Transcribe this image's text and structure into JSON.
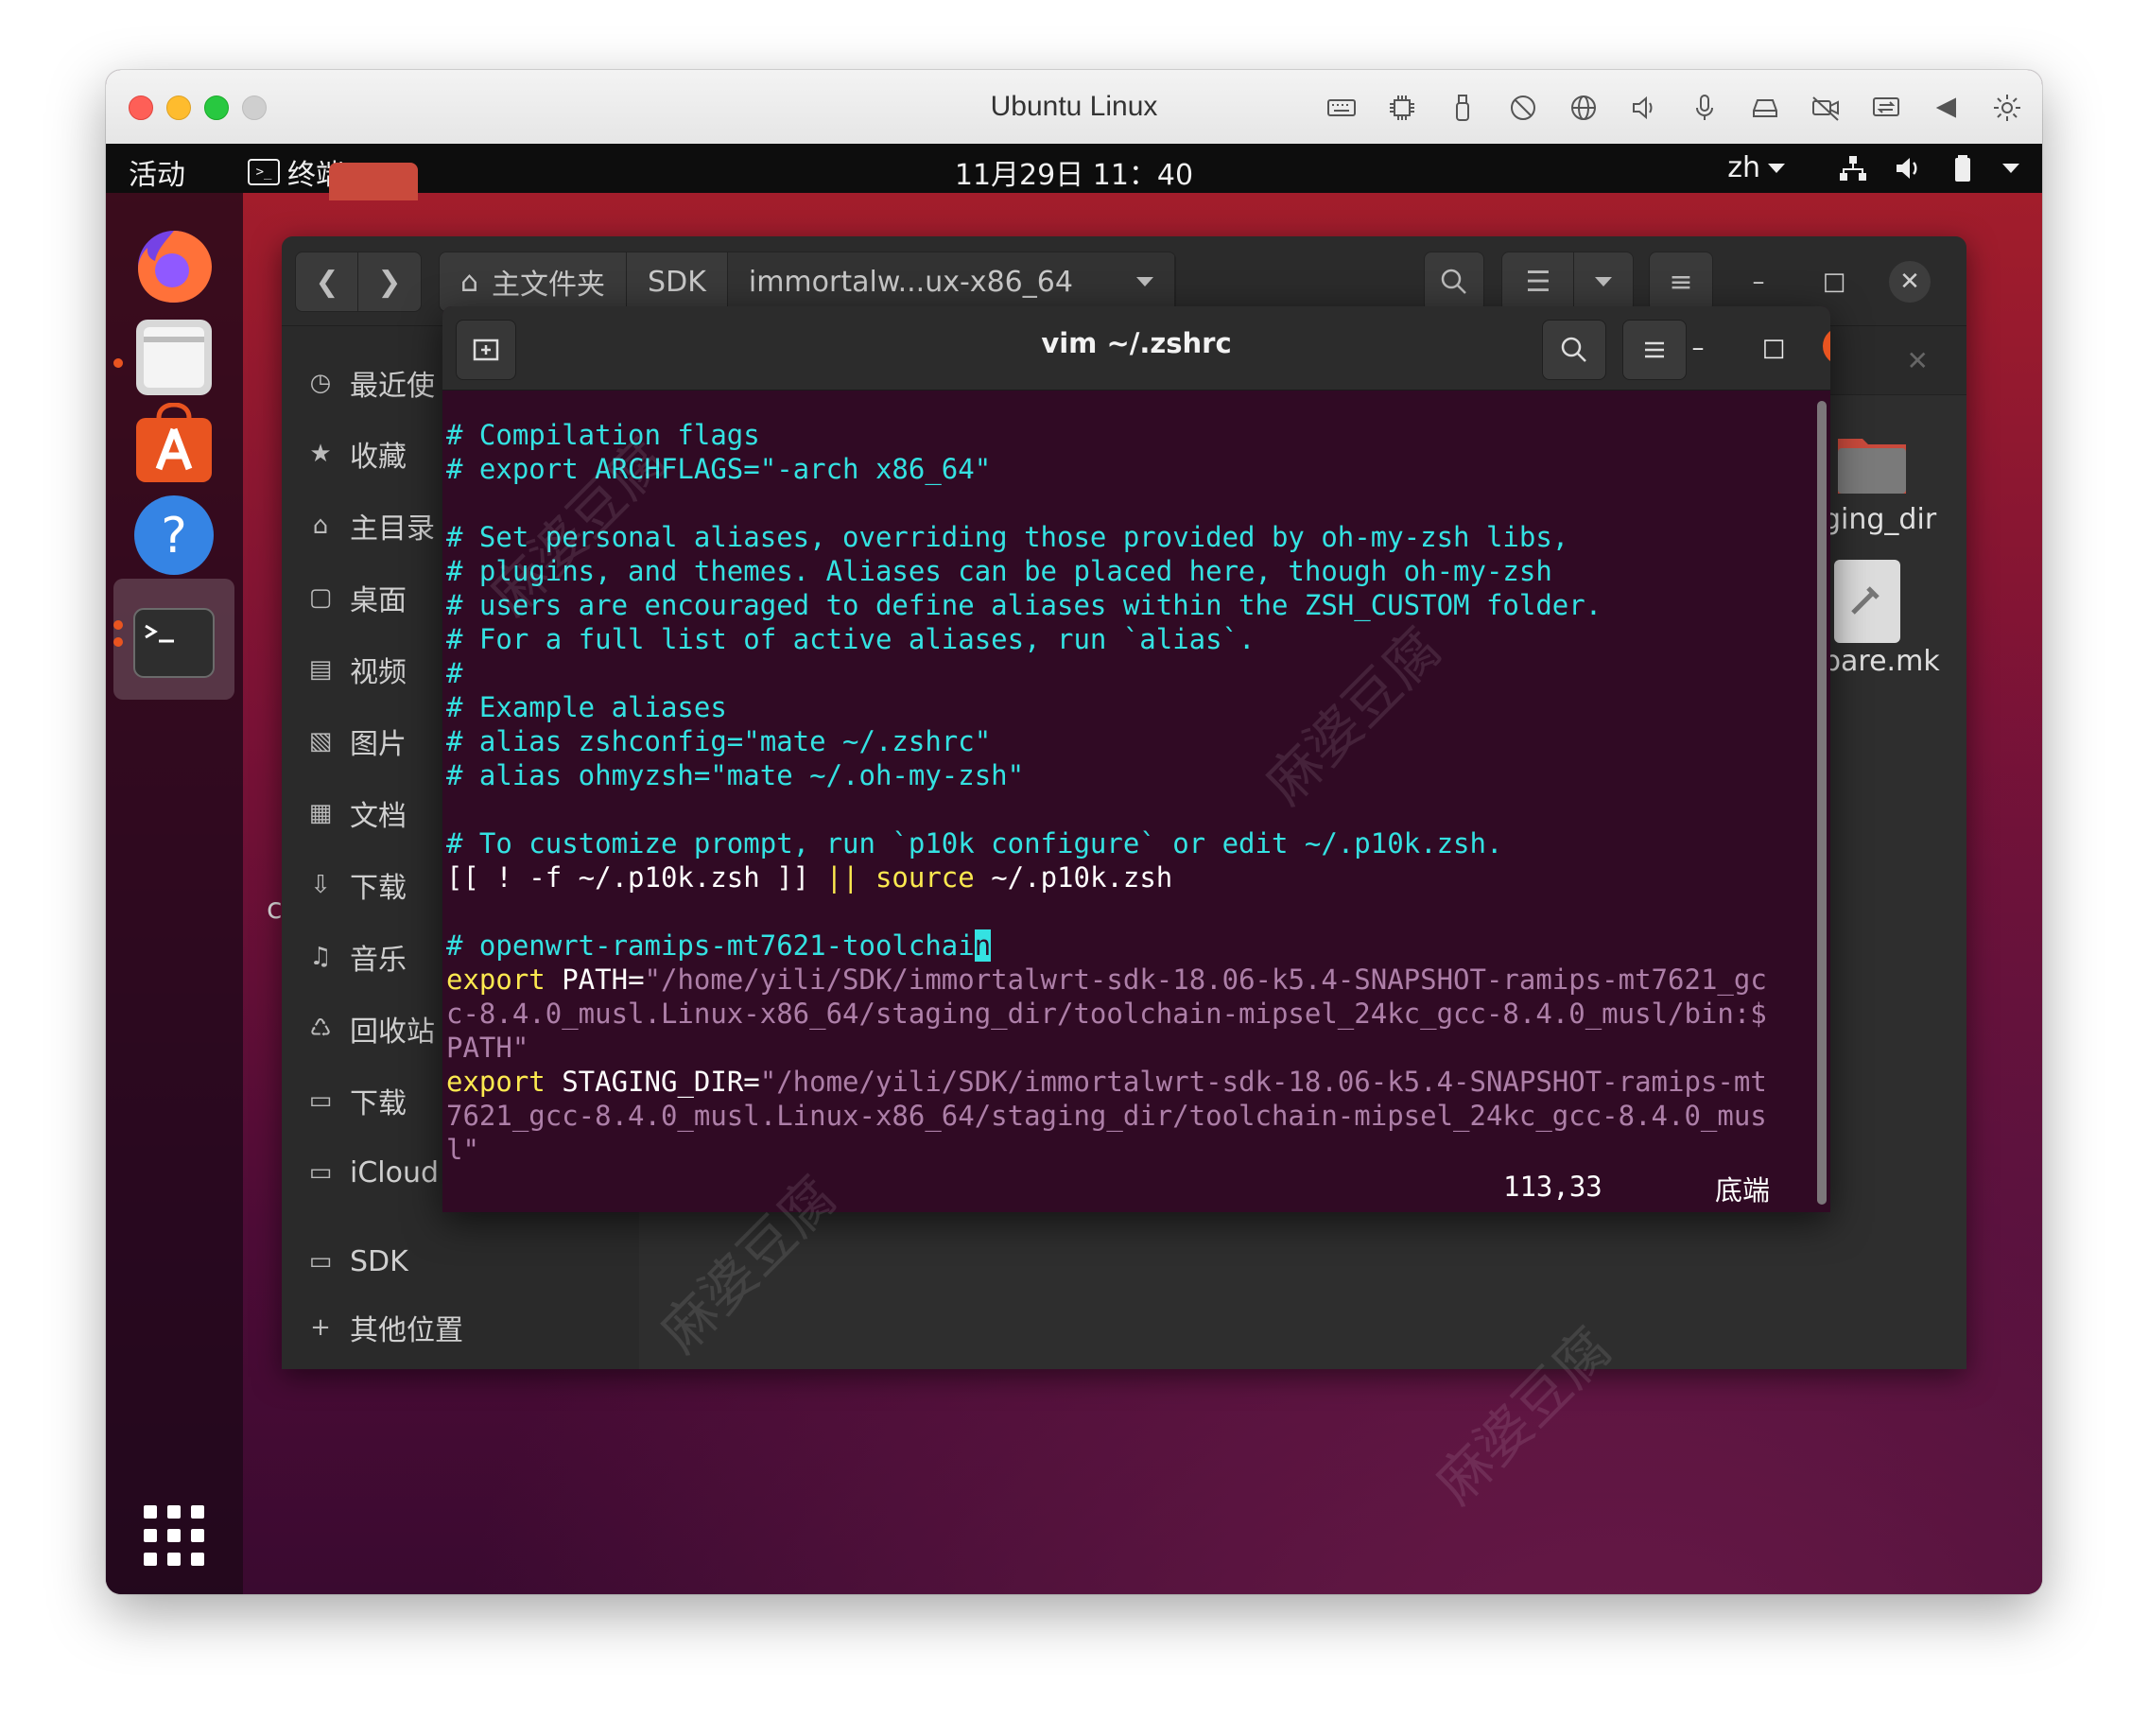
{
  "host": {
    "title": "Ubuntu Linux",
    "tools": [
      "keyboard-icon",
      "cpu-icon",
      "usb-icon",
      "disabled-icon",
      "network-globe-icon",
      "speaker-icon",
      "microphone-icon",
      "drive-icon",
      "camera-off-icon",
      "display-share-icon",
      "back-arrow-icon",
      "settings-gear-icon"
    ]
  },
  "topbar": {
    "activities": "活动",
    "app_name": "终端",
    "clock": "11月29日  11：40",
    "lang": "zh"
  },
  "files": {
    "breadcrumbs": [
      "主文件夹",
      "SDK",
      "immortalw...ux-x86_64"
    ],
    "sidebar": [
      {
        "icon": "clock-icon",
        "glyph": "◷",
        "label": "最近使"
      },
      {
        "icon": "star-icon",
        "glyph": "★",
        "label": "收藏"
      },
      {
        "icon": "home-icon",
        "glyph": "⌂",
        "label": "主目录"
      },
      {
        "icon": "desktop-icon",
        "glyph": "▢",
        "label": "桌面"
      },
      {
        "icon": "video-icon",
        "glyph": "▤",
        "label": "视频"
      },
      {
        "icon": "image-icon",
        "glyph": "▧",
        "label": "图片"
      },
      {
        "icon": "document-icon",
        "glyph": "▦",
        "label": "文档"
      },
      {
        "icon": "download-icon",
        "glyph": "⇩",
        "label": "下载"
      },
      {
        "icon": "music-icon",
        "glyph": "♫",
        "label": "音乐"
      },
      {
        "icon": "trash-icon",
        "glyph": "♺",
        "label": "回收站"
      },
      {
        "icon": "drive-icon",
        "glyph": "▭",
        "label": "下载"
      },
      {
        "icon": "drive-icon",
        "glyph": "▭",
        "label": "iCloud"
      },
      {
        "icon": "folder-icon",
        "glyph": "▭",
        "label": "SDK"
      },
      {
        "icon": "plus-icon",
        "glyph": "+",
        "label": "其他位置"
      }
    ],
    "content_items": [
      {
        "label": "ging_dir"
      },
      {
        "label": "pare.mk"
      }
    ],
    "desktop_letter": "c"
  },
  "terminal": {
    "title": "vim ~/.zshrc",
    "lines": [
      [
        [
          "c-comment",
          "# Compilation flags"
        ]
      ],
      [
        [
          "c-comment",
          "# export ARCHFLAGS=\"-arch x86_64\""
        ]
      ],
      [],
      [
        [
          "c-comment",
          "# Set personal aliases, overriding those provided by oh-my-zsh libs,"
        ]
      ],
      [
        [
          "c-comment",
          "# plugins, and themes. Aliases can be placed here, though oh-my-zsh"
        ]
      ],
      [
        [
          "c-comment",
          "# users are encouraged to define aliases within the ZSH_CUSTOM folder."
        ]
      ],
      [
        [
          "c-comment",
          "# For a full list of active aliases, run `alias`."
        ]
      ],
      [
        [
          "c-comment",
          "#"
        ]
      ],
      [
        [
          "c-comment",
          "# Example aliases"
        ]
      ],
      [
        [
          "c-comment",
          "# alias zshconfig=\"mate ~/.zshrc\""
        ]
      ],
      [
        [
          "c-comment",
          "# alias ohmyzsh=\"mate ~/.oh-my-zsh\""
        ]
      ],
      [],
      [
        [
          "c-comment",
          "# To customize prompt, run `p10k configure` or edit ~/.p10k.zsh."
        ]
      ],
      [
        [
          "c-plain",
          "[[ ! -f ~/.p10k.zsh ]] "
        ],
        [
          "c-kw",
          "||"
        ],
        [
          "c-plain",
          " "
        ],
        [
          "c-kw",
          "source"
        ],
        [
          "c-plain",
          " ~/.p10k.zsh"
        ]
      ],
      [],
      [
        [
          "c-comment",
          "# openwrt-ramips-mt7621-toolchai"
        ],
        [
          "cursor",
          "n"
        ]
      ],
      [
        [
          "c-kw",
          "export"
        ],
        [
          "c-plain",
          " PATH="
        ],
        [
          "c-str",
          "\"/home/yili/SDK/immortalwrt-sdk-18.06-k5.4-SNAPSHOT-ramips-mt7621_gc"
        ]
      ],
      [
        [
          "c-str",
          "c-8.4.0_musl.Linux-x86_64/staging_dir/toolchain-mipsel_24kc_gcc-8.4.0_musl/bin:$"
        ]
      ],
      [
        [
          "c-str",
          "PATH\""
        ]
      ],
      [
        [
          "c-kw",
          "export"
        ],
        [
          "c-plain",
          " STAGING_DIR="
        ],
        [
          "c-str",
          "\"/home/yili/SDK/immortalwrt-sdk-18.06-k5.4-SNAPSHOT-ramips-mt"
        ]
      ],
      [
        [
          "c-str",
          "7621_gcc-8.4.0_musl.Linux-x86_64/staging_dir/toolchain-mipsel_24kc_gcc-8.4.0_mus"
        ]
      ],
      [
        [
          "c-str",
          "l\""
        ]
      ]
    ],
    "status_position": "113,33",
    "status_where": "底端"
  },
  "watermark": "麻婆豆腐"
}
